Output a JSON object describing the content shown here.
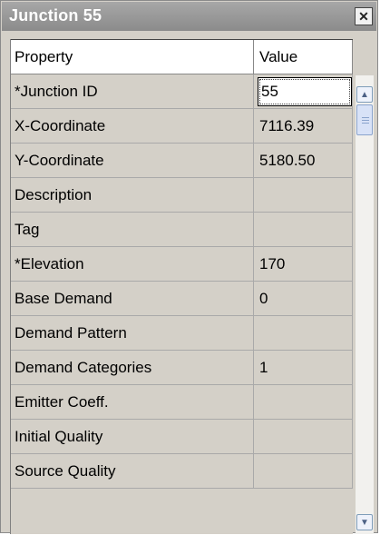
{
  "window": {
    "title": "Junction 55",
    "close_glyph": "✕"
  },
  "grid": {
    "header": {
      "property": "Property",
      "value": "Value"
    },
    "rows": [
      {
        "property": "*Junction ID",
        "value": "55"
      },
      {
        "property": "X-Coordinate",
        "value": "7116.39"
      },
      {
        "property": "Y-Coordinate",
        "value": "5180.50"
      },
      {
        "property": "Description",
        "value": ""
      },
      {
        "property": "Tag",
        "value": ""
      },
      {
        "property": "*Elevation",
        "value": "170"
      },
      {
        "property": "Base Demand",
        "value": "0"
      },
      {
        "property": "Demand Pattern",
        "value": ""
      },
      {
        "property": "Demand Categories",
        "value": "1"
      },
      {
        "property": "Emitter Coeff.",
        "value": ""
      },
      {
        "property": "Initial Quality",
        "value": ""
      },
      {
        "property": "Source Quality",
        "value": ""
      }
    ]
  },
  "scrollbar": {
    "up_glyph": "▲",
    "down_glyph": "▼"
  }
}
